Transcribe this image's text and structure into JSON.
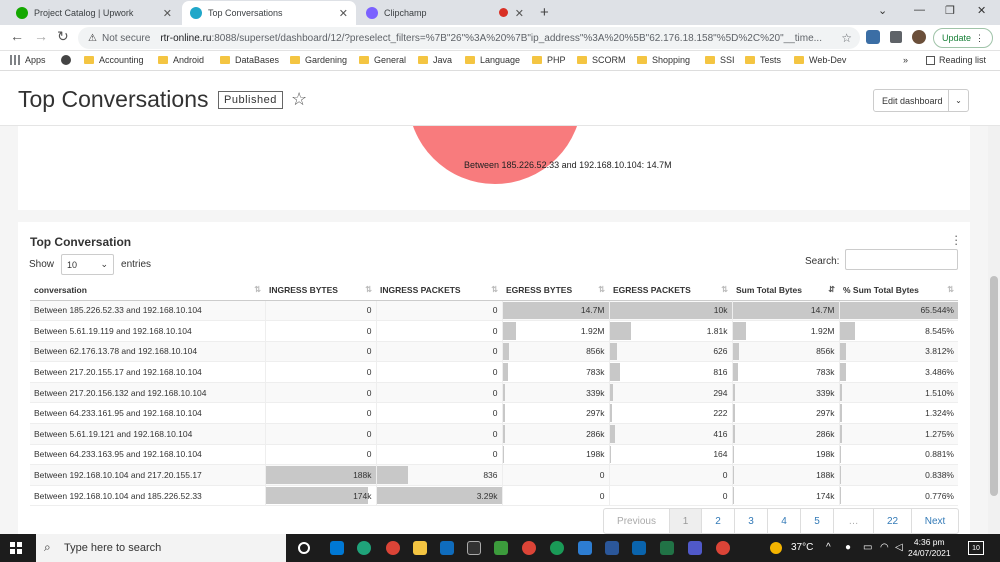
{
  "browser": {
    "tabs": [
      {
        "title": "Project Catalog | Upwork",
        "fav_color": "#14a800",
        "active": false
      },
      {
        "title": "Top Conversations",
        "fav_color": "#20a7c9",
        "active": true
      },
      {
        "title": "Clipchamp",
        "fav_color": "#7b61ff",
        "active": false
      }
    ],
    "not_secure": "Not secure",
    "url_host": "rtr-online.ru",
    "url_path": ":8088/superset/dashboard/12/?preselect_filters=%7B\"26\"%3A%20%7B\"ip_address\"%3A%20%5B\"62.176.18.158\"%5D%2C%20\"__time...",
    "update_label": "Update",
    "bookmarks": [
      "Apps",
      "Accounting",
      "Android",
      "DataBases",
      "Gardening",
      "General",
      "Java",
      "Language",
      "PHP",
      "SCORM",
      "Shopping",
      "SSI",
      "Tests",
      "Web-Dev"
    ],
    "reading_list": "Reading list"
  },
  "dashboard": {
    "title": "Top Conversations",
    "status": "Published",
    "edit_label": "Edit dashboard"
  },
  "pie": {
    "label": "Between 185.226.52.33 and 192.168.10.104: 14.7M",
    "color": "#f87b7d"
  },
  "table_card": {
    "title": "Top Conversation",
    "show_label": "Show",
    "entries_value": "10",
    "entries_label": "entries",
    "search_label": "Search:",
    "columns": [
      "conversation",
      "INGRESS BYTES",
      "INGRESS PACKETS",
      "EGRESS BYTES",
      "EGRESS PACKETS",
      "Sum Total Bytes",
      "% Sum Total Bytes"
    ],
    "rows": [
      {
        "conv": "Between 185.226.52.33 and 192.168.10.104",
        "ib": "0",
        "ip": "0",
        "eb": "14.7M",
        "ep": "10k",
        "st": "14.7M",
        "pct": "65.544%"
      },
      {
        "conv": "Between 5.61.19.119 and 192.168.10.104",
        "ib": "0",
        "ip": "0",
        "eb": "1.92M",
        "ep": "1.81k",
        "st": "1.92M",
        "pct": "8.545%"
      },
      {
        "conv": "Between 62.176.13.78 and 192.168.10.104",
        "ib": "0",
        "ip": "0",
        "eb": "856k",
        "ep": "626",
        "st": "856k",
        "pct": "3.812%"
      },
      {
        "conv": "Between 217.20.155.17 and 192.168.10.104",
        "ib": "0",
        "ip": "0",
        "eb": "783k",
        "ep": "816",
        "st": "783k",
        "pct": "3.486%"
      },
      {
        "conv": "Between 217.20.156.132 and 192.168.10.104",
        "ib": "0",
        "ip": "0",
        "eb": "339k",
        "ep": "294",
        "st": "339k",
        "pct": "1.510%"
      },
      {
        "conv": "Between 64.233.161.95 and 192.168.10.104",
        "ib": "0",
        "ip": "0",
        "eb": "297k",
        "ep": "222",
        "st": "297k",
        "pct": "1.324%"
      },
      {
        "conv": "Between 5.61.19.121 and 192.168.10.104",
        "ib": "0",
        "ip": "0",
        "eb": "286k",
        "ep": "416",
        "st": "286k",
        "pct": "1.275%"
      },
      {
        "conv": "Between 64.233.163.95 and 192.168.10.104",
        "ib": "0",
        "ip": "0",
        "eb": "198k",
        "ep": "164",
        "st": "198k",
        "pct": "0.881%"
      },
      {
        "conv": "Between 192.168.10.104 and 217.20.155.17",
        "ib": "188k",
        "ip": "836",
        "eb": "0",
        "ep": "0",
        "st": "188k",
        "pct": "0.838%"
      },
      {
        "conv": "Between 192.168.10.104 and 185.226.52.33",
        "ib": "174k",
        "ip": "3.29k",
        "eb": "0",
        "ep": "0",
        "st": "174k",
        "pct": "0.776%"
      }
    ],
    "bar_fractions": [
      {
        "ib": 0,
        "ip": 0,
        "eb": 1.0,
        "ep": 1.0,
        "st": 1.0,
        "pct": 1.0
      },
      {
        "ib": 0,
        "ip": 0,
        "eb": 0.13,
        "ep": 0.18,
        "st": 0.13,
        "pct": 0.13
      },
      {
        "ib": 0,
        "ip": 0,
        "eb": 0.058,
        "ep": 0.063,
        "st": 0.058,
        "pct": 0.058
      },
      {
        "ib": 0,
        "ip": 0,
        "eb": 0.053,
        "ep": 0.082,
        "st": 0.053,
        "pct": 0.053
      },
      {
        "ib": 0,
        "ip": 0,
        "eb": 0.023,
        "ep": 0.029,
        "st": 0.023,
        "pct": 0.023
      },
      {
        "ib": 0,
        "ip": 0,
        "eb": 0.02,
        "ep": 0.022,
        "st": 0.02,
        "pct": 0.02
      },
      {
        "ib": 0,
        "ip": 0,
        "eb": 0.019,
        "ep": 0.042,
        "st": 0.019,
        "pct": 0.019
      },
      {
        "ib": 0,
        "ip": 0,
        "eb": 0.013,
        "ep": 0.016,
        "st": 0.013,
        "pct": 0.013
      },
      {
        "ib": 1.0,
        "ip": 0.25,
        "eb": 0,
        "ep": 0,
        "st": 0.013,
        "pct": 0.013
      },
      {
        "ib": 0.93,
        "ip": 1.0,
        "eb": 0,
        "ep": 0,
        "st": 0.012,
        "pct": 0.012
      }
    ],
    "pager": [
      "Previous",
      "1",
      "2",
      "3",
      "4",
      "5",
      "…",
      "22",
      "Next"
    ]
  },
  "taskbar": {
    "search_placeholder": "Type here to search",
    "weather": "37°C",
    "time": "4:36 pm",
    "date": "24/07/2021",
    "notif": "10"
  }
}
